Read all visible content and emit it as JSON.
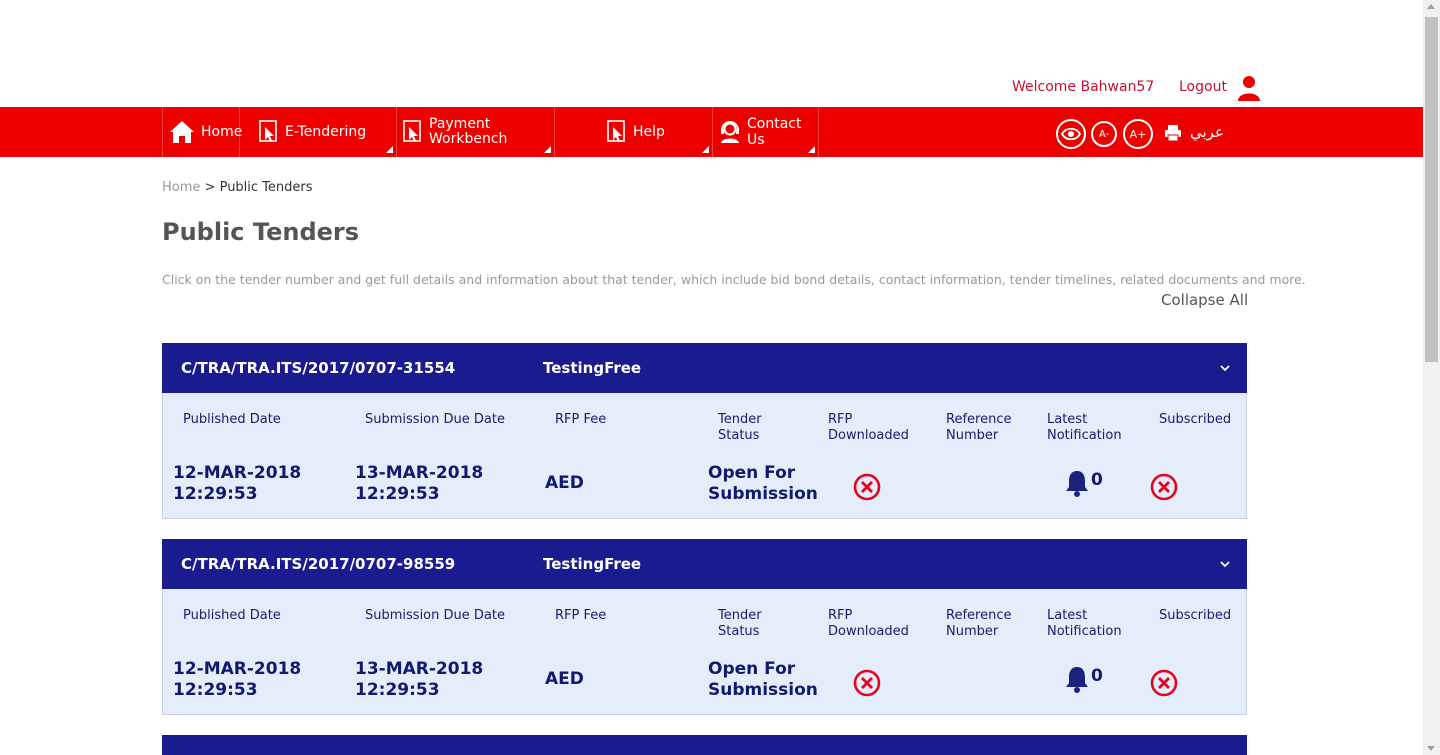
{
  "header": {
    "welcome": "Welcome Bahwan57",
    "logout": "Logout"
  },
  "nav": {
    "items": [
      {
        "label": "Home",
        "icon": "home-icon"
      },
      {
        "label": "E-Tendering",
        "icon": "cursor-click-icon"
      },
      {
        "label": "Payment",
        "label2": "Workbench",
        "icon": "cursor-click-icon"
      },
      {
        "label": "Help",
        "icon": "cursor-click-icon"
      },
      {
        "label": "Contact Us",
        "icon": "support-agent-icon"
      }
    ],
    "tools": {
      "decrease_font": "A-",
      "increase_font": "A+",
      "arabic": "عربي"
    }
  },
  "breadcrumb": {
    "home": "Home",
    "separator": ">",
    "current": "Public Tenders"
  },
  "page": {
    "title": "Public Tenders",
    "description": "Click on the tender number and get full details and information about that tender, which include bid bond details, contact information, tender timelines, related documents and more.",
    "collapse_all": "Collapse All"
  },
  "columns": {
    "published": "Published Date",
    "due": "Submission Due Date",
    "fee": "RFP Fee",
    "status_1": "Tender",
    "status_2": "Status",
    "downloaded_1": "RFP",
    "downloaded_2": "Downloaded",
    "reference_1": "Reference",
    "reference_2": "Number",
    "notification_1": "Latest",
    "notification_2": "Notification",
    "subscribed": "Subscribed"
  },
  "tenders": [
    {
      "number": "C/TRA/TRA.ITS/2017/0707-31554",
      "name": "TestingFree",
      "published_date": "12-MAR-2018",
      "published_time": "12:29:53",
      "due_date": "13-MAR-2018",
      "due_time": "12:29:53",
      "fee": "AED",
      "status_1": "Open For",
      "status_2": "Submission",
      "notifications": "0"
    },
    {
      "number": "C/TRA/TRA.ITS/2017/0707-98559",
      "name": "TestingFree",
      "published_date": "12-MAR-2018",
      "published_time": "12:29:53",
      "due_date": "13-MAR-2018",
      "due_time": "12:29:53",
      "fee": "AED",
      "status_1": "Open For",
      "status_2": "Submission",
      "notifications": "0"
    }
  ],
  "colors": {
    "brand_red": "#ee0000",
    "tender_header": "#191b8e",
    "card_body": "#e4edf9",
    "x_icon": "#e8001c",
    "bell": "#1a237e"
  }
}
